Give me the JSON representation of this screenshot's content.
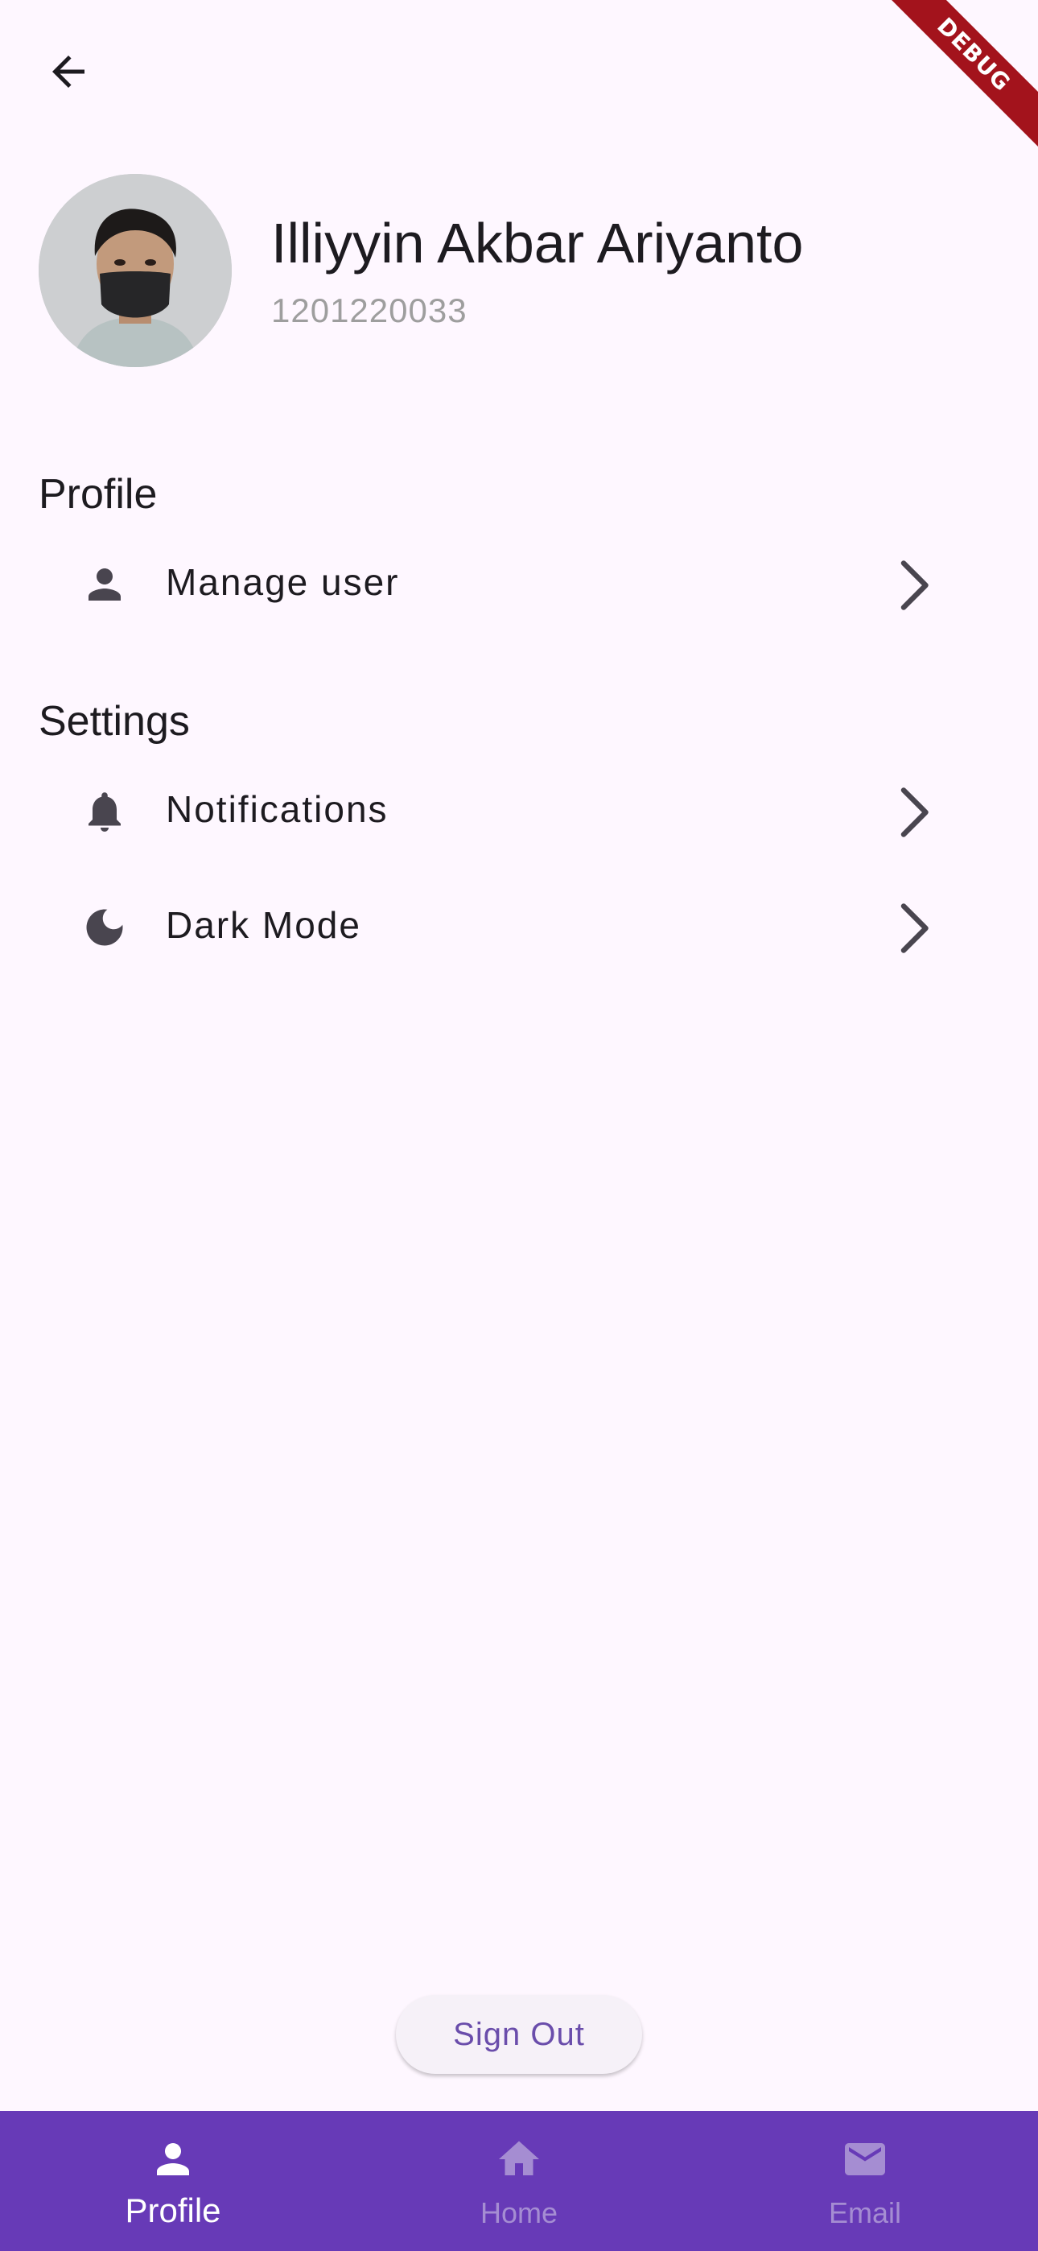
{
  "app_bar": {
    "back_icon": "arrow-back-icon"
  },
  "debug_banner": {
    "label": "DEBUG",
    "color": "#a3131c"
  },
  "profile_header": {
    "name": "Illiyyin Akbar Ariyanto",
    "id_number": "1201220033"
  },
  "sections": {
    "profile": {
      "title": "Profile",
      "items": [
        {
          "label": "Manage user",
          "icon": "person-icon"
        }
      ]
    },
    "settings": {
      "title": "Settings",
      "items": [
        {
          "label": "Notifications",
          "icon": "bell-icon"
        },
        {
          "label": "Dark Mode",
          "icon": "moon-icon"
        }
      ]
    }
  },
  "sign_out": {
    "label": "Sign Out"
  },
  "bottom_nav": {
    "items": [
      {
        "label": "Profile",
        "icon": "person-icon",
        "active": true
      },
      {
        "label": "Home",
        "icon": "home-icon",
        "active": false
      },
      {
        "label": "Email",
        "icon": "mail-icon",
        "active": false
      }
    ]
  },
  "colors": {
    "background": "#fef7ff",
    "accent": "#673ab7",
    "button_text": "#6a4dab",
    "secondary_text": "#9e9e9e",
    "icon": "#49454f"
  }
}
